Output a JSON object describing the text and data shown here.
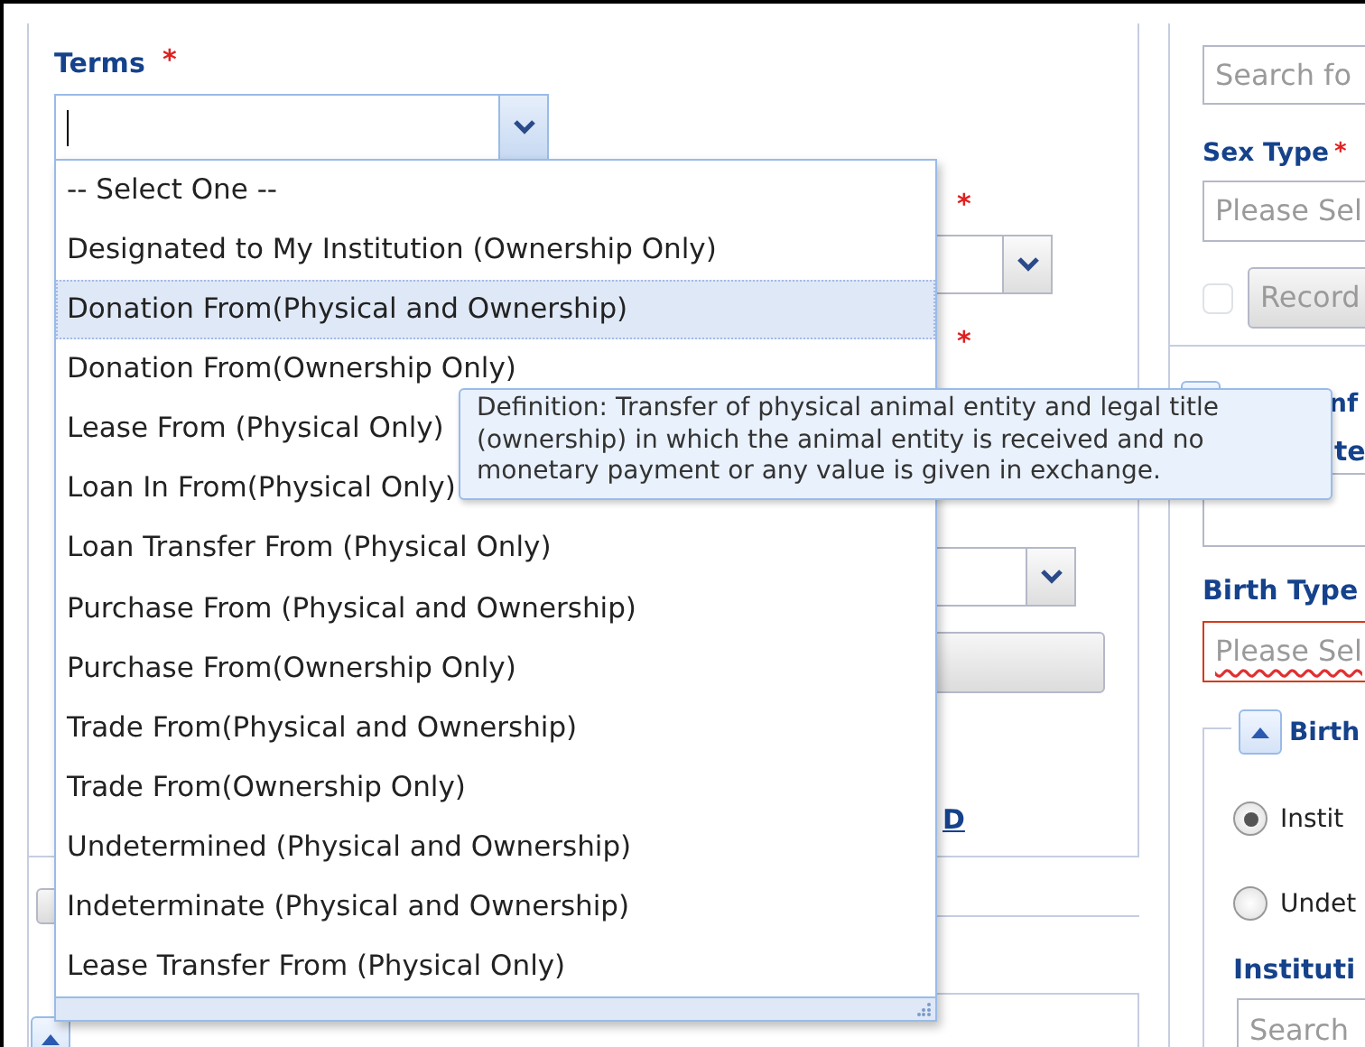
{
  "terms_field": {
    "label": "Terms",
    "required_mark": "*"
  },
  "terms_dropdown": {
    "options": [
      {
        "label": "-- Select One --",
        "selected": false
      },
      {
        "label": "Designated to My Institution (Ownership Only)",
        "selected": false
      },
      {
        "label": "Donation From(Physical and Ownership)",
        "selected": true
      },
      {
        "label": "Donation From(Ownership Only)",
        "selected": false
      },
      {
        "label": "Lease From (Physical Only)",
        "selected": false
      },
      {
        "label": "Loan In From(Physical Only)",
        "selected": false
      },
      {
        "label": "Loan Transfer From (Physical Only)",
        "selected": false
      },
      {
        "label": "Purchase From (Physical and Ownership)",
        "selected": false
      },
      {
        "label": "Purchase From(Ownership Only)",
        "selected": false
      },
      {
        "label": "Trade From(Physical and Ownership)",
        "selected": false
      },
      {
        "label": "Trade From(Ownership Only)",
        "selected": false
      },
      {
        "label": "Undetermined (Physical and Ownership)",
        "selected": false
      },
      {
        "label": "Indeterminate (Physical and Ownership)",
        "selected": false
      },
      {
        "label": "Lease Transfer From (Physical Only)",
        "selected": false
      }
    ]
  },
  "tooltip": {
    "text": "Definition: Transfer of physical animal entity and legal title (ownership) in which the animal entity is received and no monetary payment or any value is given in exchange."
  },
  "left_form": {
    "required_marks": [
      "*",
      "*"
    ],
    "link": "D"
  },
  "right_form": {
    "taxonomy_search": {
      "placeholder": "Search fo"
    },
    "sex_type": {
      "label": "Sex Type",
      "required_mark": "*",
      "placeholder": "Please Sel"
    },
    "record": {
      "checked": false,
      "button": "Record"
    },
    "section_label_fragments": [
      "nf",
      "te"
    ],
    "birth_type": {
      "label": "Birth Type",
      "placeholder": "Please Sel",
      "invalid": true
    },
    "birth_section": {
      "title": "Birth",
      "expanded": true
    },
    "birth_options": [
      {
        "label": "Instit",
        "selected": true
      },
      {
        "label": "Undet",
        "selected": false
      }
    ],
    "institution": {
      "label": "Instituti",
      "placeholder": "Search"
    }
  }
}
